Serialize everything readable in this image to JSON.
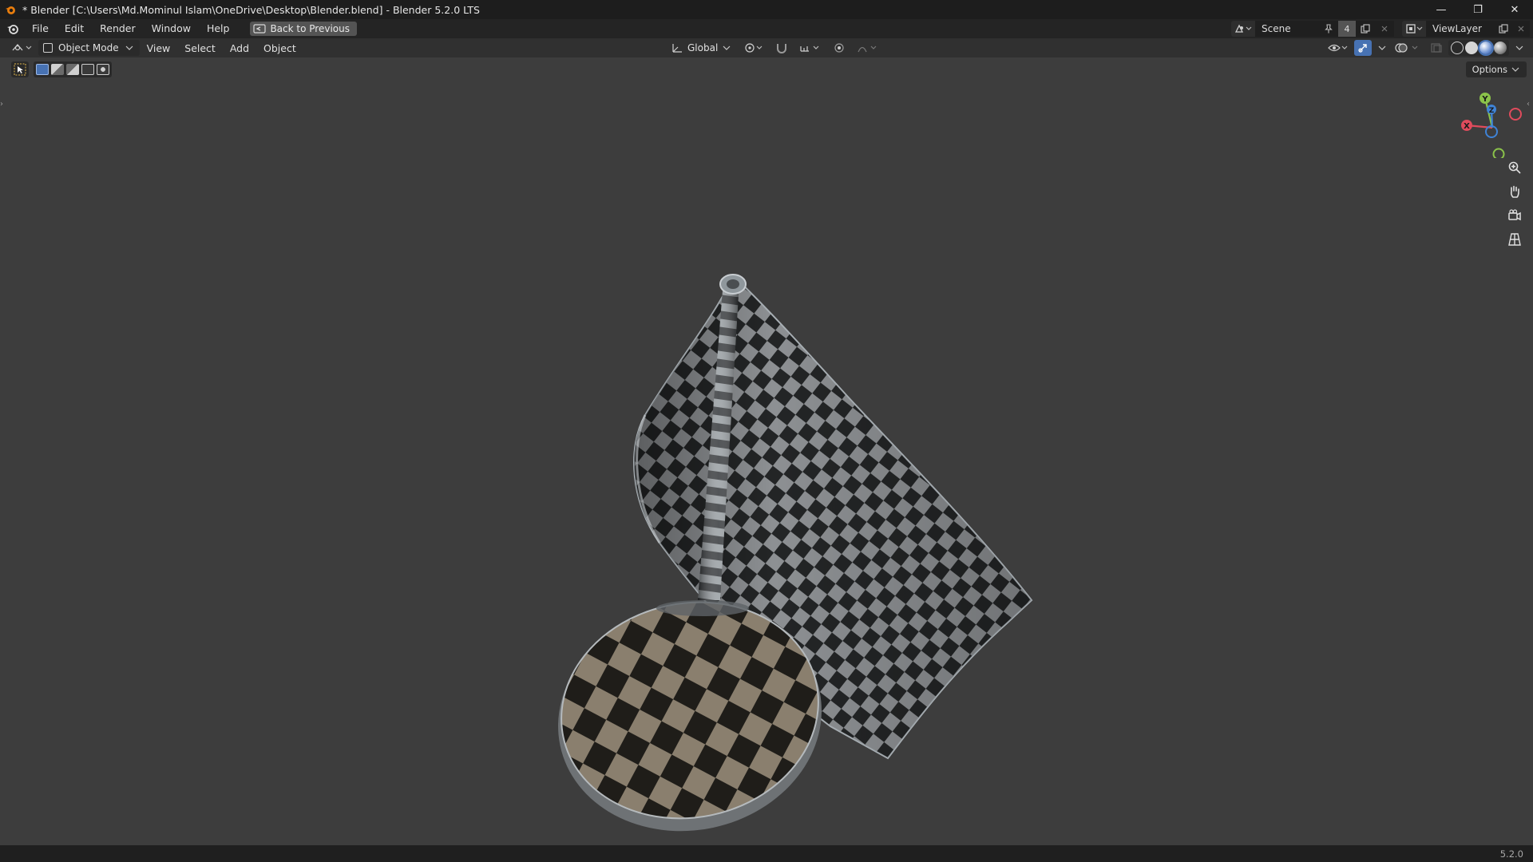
{
  "window": {
    "title": "* Blender [C:\\Users\\Md.Mominul Islam\\OneDrive\\Desktop\\Blender.blend] - Blender 5.2.0 LTS",
    "minimize_glyph": "—",
    "maximize_glyph": "❐",
    "close_glyph": "✕"
  },
  "topbar": {
    "menus": [
      "File",
      "Edit",
      "Render",
      "Window",
      "Help"
    ],
    "back_button": "Back to Previous",
    "scene": {
      "name": "Scene",
      "users": "4"
    },
    "view_layer": "ViewLayer"
  },
  "viewport_header": {
    "mode": "Object Mode",
    "menus": [
      "View",
      "Select",
      "Add",
      "Object"
    ],
    "transform_orientation": "Global"
  },
  "tool_header": {
    "options_label": "Options"
  },
  "gizmo": {
    "x_label": "X",
    "y_label": "Y",
    "z_label": "Z",
    "x_color": "#e04b5c",
    "y_color": "#8bc34a",
    "z_color": "#3f83d6"
  },
  "nav_buttons": [
    "zoom-icon",
    "pan-hand-icon",
    "camera-view-icon",
    "perspective-grid-icon"
  ],
  "statusbar": {
    "version": "5.2.0"
  },
  "colors": {
    "viewport_bg": "#3d3d3d",
    "checker_light": "#8d9093",
    "checker_dark": "#232526",
    "base_light": "#8a7f6e",
    "base_dark": "#1f1d19"
  }
}
